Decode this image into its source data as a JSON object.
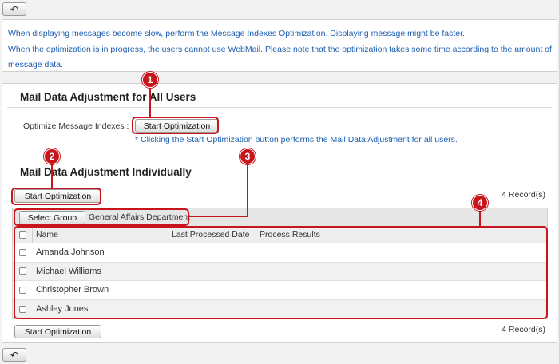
{
  "nav": {
    "back_symbol": "↶"
  },
  "info": {
    "line1": "When displaying messages become slow, perform the Message Indexes Optimization. Displaying message might be faster.",
    "line2": "When the optimization is in progress, the users cannot use WebMail. Please note that the optimization takes some time according to the amount of",
    "line3": "message data."
  },
  "section_all": {
    "title": "Mail Data Adjustment for All Users",
    "optimize_label": "Optimize Message Indexes :",
    "button": "Start Optimization",
    "note": "* Clicking the Start Optimization button performs the Mail Data Adjustment for all users."
  },
  "section_individual": {
    "title": "Mail Data Adjustment Individually",
    "button_top": "Start Optimization",
    "button_bottom": "Start Optimization",
    "records_top": "4 Record(s)",
    "records_bottom": "4 Record(s)",
    "select_group_button": "Select Group",
    "group_name": "General Affairs Department",
    "columns": [
      "Name",
      "Last Processed Date",
      "Process Results"
    ],
    "rows": [
      {
        "name": "Amanda Johnson",
        "date": "",
        "result": ""
      },
      {
        "name": "Michael Williams",
        "date": "",
        "result": ""
      },
      {
        "name": "Christopher Brown",
        "date": "",
        "result": ""
      },
      {
        "name": "Ashley Jones",
        "date": "",
        "result": ""
      }
    ]
  },
  "annotations": [
    "1",
    "2",
    "3",
    "4"
  ],
  "colors": {
    "accent_red": "#c8141c",
    "info_blue": "#1e5fb0"
  }
}
